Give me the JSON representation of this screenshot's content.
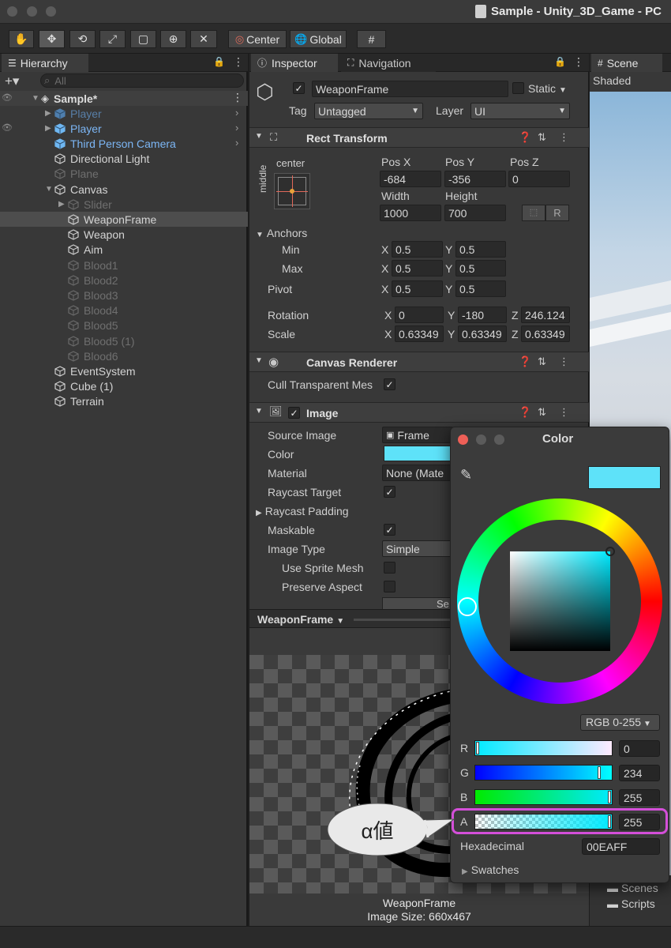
{
  "window": {
    "title": "Sample - Unity_3D_Game - PC"
  },
  "toolbar": {
    "center_label": "Center",
    "global_label": "Global"
  },
  "hierarchy": {
    "tab_label": "Hierarchy",
    "search_placeholder": "All",
    "scene_name": "Sample*",
    "items": [
      {
        "label": "Player",
        "style": "blue-dim"
      },
      {
        "label": "Player",
        "style": "blue"
      },
      {
        "label": "Third Person Camera",
        "style": "blue"
      },
      {
        "label": "Directional Light",
        "style": "normal"
      },
      {
        "label": "Plane",
        "style": "dim"
      },
      {
        "label": "Canvas",
        "style": "normal"
      },
      {
        "label": "Slider",
        "style": "dim"
      },
      {
        "label": "WeaponFrame",
        "style": "normal"
      },
      {
        "label": "Weapon",
        "style": "normal"
      },
      {
        "label": "Aim",
        "style": "normal"
      },
      {
        "label": "Blood1",
        "style": "dim"
      },
      {
        "label": "Blood2",
        "style": "dim"
      },
      {
        "label": "Blood3",
        "style": "dim"
      },
      {
        "label": "Blood4",
        "style": "dim"
      },
      {
        "label": "Blood5",
        "style": "dim"
      },
      {
        "label": "Blood5 (1)",
        "style": "dim"
      },
      {
        "label": "Blood6",
        "style": "dim"
      },
      {
        "label": "EventSystem",
        "style": "normal"
      },
      {
        "label": "Cube (1)",
        "style": "normal"
      },
      {
        "label": "Terrain",
        "style": "normal"
      }
    ]
  },
  "inspector": {
    "tab_label": "Inspector",
    "nav_tab_label": "Navigation",
    "object_name": "WeaponFrame",
    "static_label": "Static",
    "tag_label": "Tag",
    "tag_value": "Untagged",
    "layer_label": "Layer",
    "layer_value": "UI",
    "rect_transform": {
      "title": "Rect Transform",
      "anchor_h": "center",
      "anchor_v": "middle",
      "posx_label": "Pos X",
      "posx": "-684",
      "posy_label": "Pos Y",
      "posy": "-356",
      "posz_label": "Pos Z",
      "posz": "0",
      "width_label": "Width",
      "width": "1000",
      "height_label": "Height",
      "height": "700",
      "r_button": "R",
      "anchors_label": "Anchors",
      "min_label": "Min",
      "min_x": "0.5",
      "min_y": "0.5",
      "max_label": "Max",
      "max_x": "0.5",
      "max_y": "0.5",
      "pivot_label": "Pivot",
      "pivot_x": "0.5",
      "pivot_y": "0.5",
      "rotation_label": "Rotation",
      "rot_x": "0",
      "rot_y": "-180",
      "rot_z": "246.124",
      "scale_label": "Scale",
      "scale_x": "0.63349",
      "scale_y": "0.63349",
      "scale_z": "0.63349",
      "x": "X",
      "y": "Y",
      "z": "Z"
    },
    "canvas_renderer": {
      "title": "Canvas Renderer",
      "cull_label": "Cull Transparent Mes"
    },
    "image": {
      "title": "Image",
      "source_label": "Source Image",
      "source_value": "Frame",
      "color_label": "Color",
      "material_label": "Material",
      "material_value": "None (Mate",
      "raycast_target_label": "Raycast Target",
      "raycast_padding_label": "Raycast Padding",
      "maskable_label": "Maskable",
      "image_type_label": "Image Type",
      "image_type_value": "Simple",
      "use_sprite_mesh_label": "Use Sprite Mesh",
      "preserve_aspect_label": "Preserve Aspect",
      "set_native_label": "Se"
    },
    "preview": {
      "dropdown_label": "WeaponFrame",
      "caption_name": "WeaponFrame",
      "caption_size": "Image Size: 660x467"
    }
  },
  "scene": {
    "tab_label": "Scene",
    "shaded_label": "Shaded",
    "folder1": "Scenes",
    "folder2": "Scripts"
  },
  "color_picker": {
    "title": "Color",
    "swatch_color": "#5EE2F9",
    "mode_label": "RGB 0-255",
    "r_label": "R",
    "r_value": "0",
    "g_label": "G",
    "g_value": "234",
    "b_label": "B",
    "b_value": "255",
    "a_label": "A",
    "a_value": "255",
    "hex_label": "Hexadecimal",
    "hex_value": "00EAFF",
    "swatches_label": "Swatches"
  },
  "annotation": {
    "callout_text": "α値",
    "highlight_color": "#d44fd9"
  }
}
